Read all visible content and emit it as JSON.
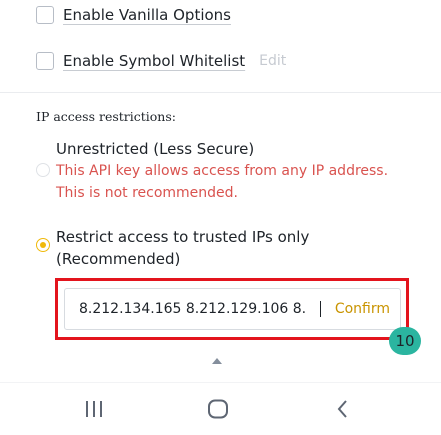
{
  "options": {
    "vanilla_label": "Enable Vanilla Options",
    "symbol_whitelist_label": "Enable Symbol Whitelist",
    "edit_label": "Edit"
  },
  "ip_access": {
    "section_label": "IP access restrictions:",
    "unrestricted": {
      "title": "Unrestricted (Less Secure)",
      "warning_line1": "This API key allows access from any IP address.",
      "warning_line2": "This is not recommended."
    },
    "restricted": {
      "title_line1": "Restrict access to trusted IPs only",
      "title_line2": "(Recommended)"
    },
    "ip_input_value": "8.212.134.165 8.212.129.106 8.",
    "confirm_label": "Confirm"
  },
  "step_badge": "10",
  "nav": {
    "recent_icon": "recent-apps-icon",
    "home_icon": "home-icon",
    "back_icon": "back-icon"
  },
  "colors": {
    "accent": "#f0b90b",
    "confirm_text": "#c99400",
    "warning": "#d9534f",
    "highlight_border": "#e3141d",
    "badge": "#2bb5a0"
  }
}
